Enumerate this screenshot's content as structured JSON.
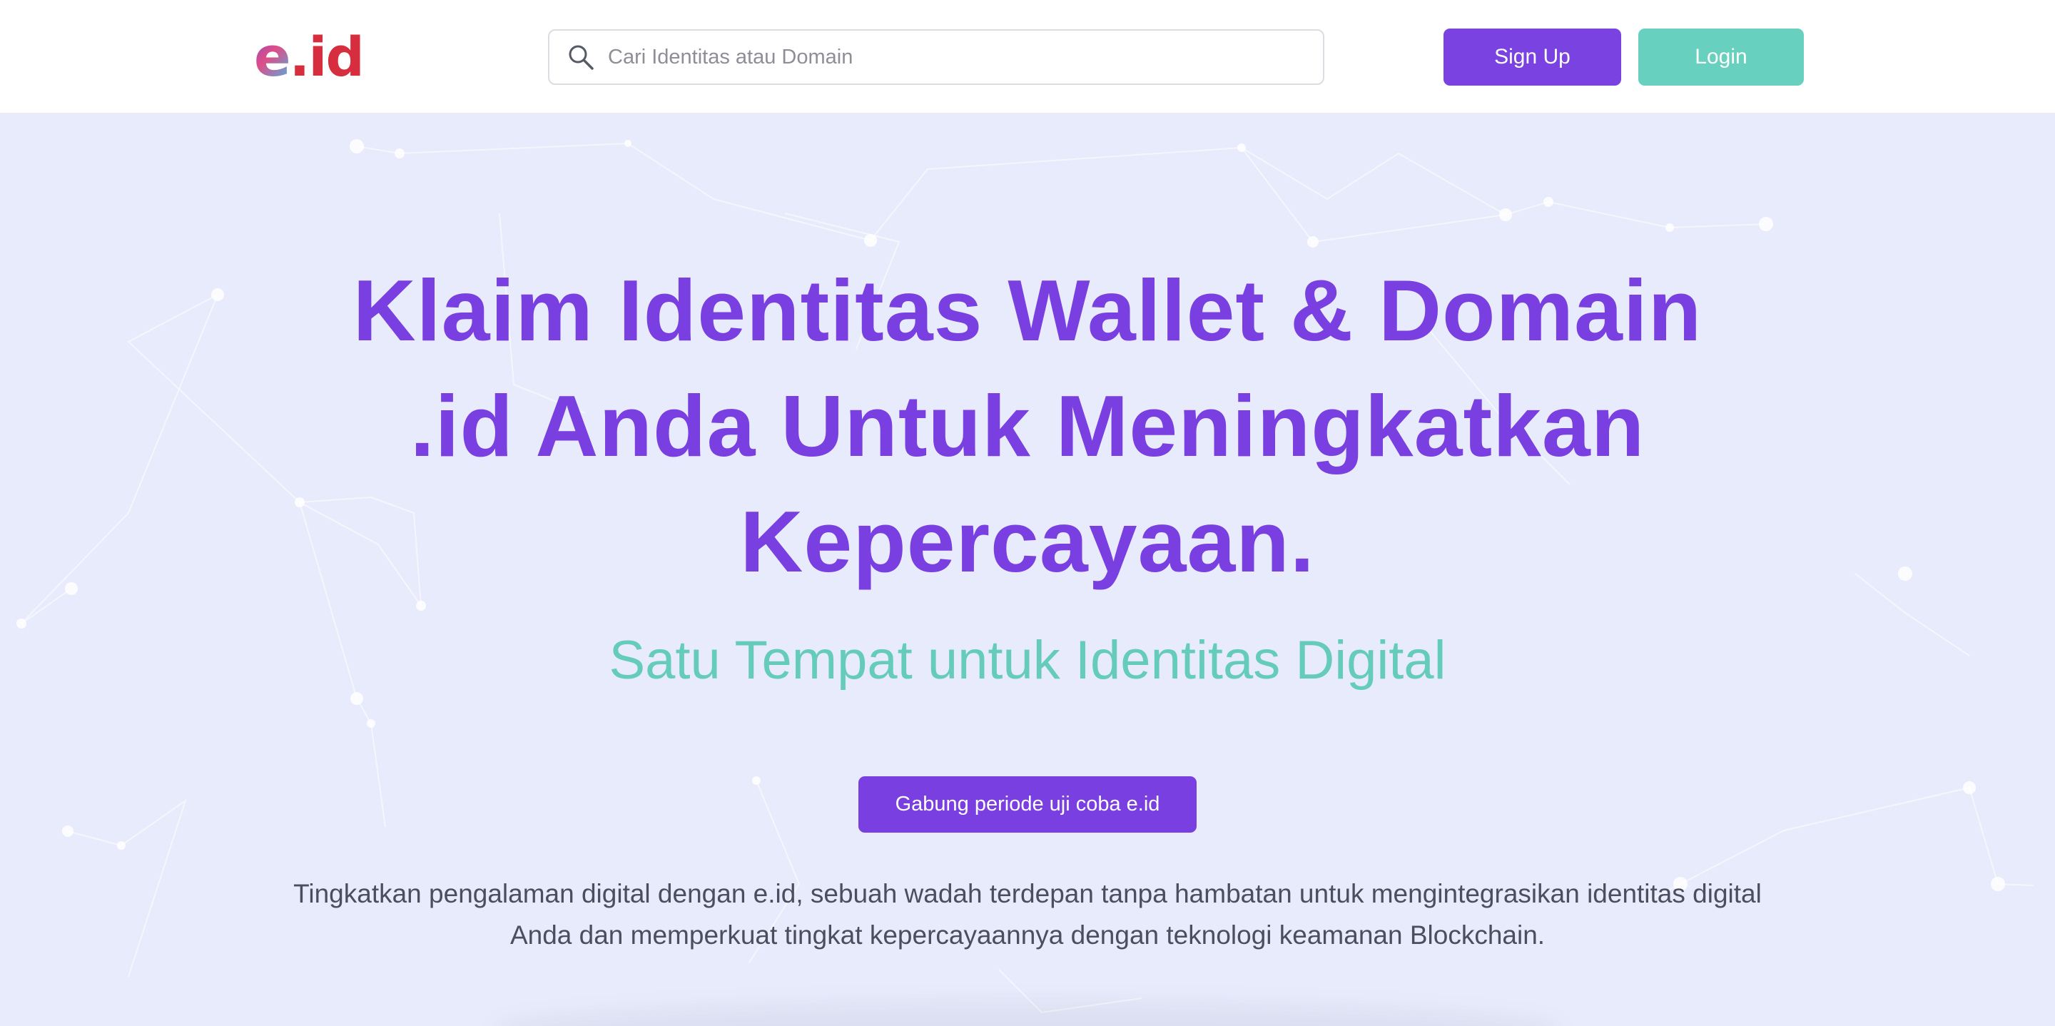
{
  "brand": {
    "logo_e": "e",
    "logo_id": ".id",
    "primary_color": "#7a3fe0",
    "accent_color": "#67d0bf"
  },
  "header": {
    "search": {
      "placeholder": "Cari Identitas atau Domain",
      "value": "",
      "icon": "search-icon"
    },
    "signup_label": "Sign Up",
    "login_label": "Login"
  },
  "hero": {
    "title_lines": [
      "Klaim Identitas Wallet & Domain",
      ".id Anda Untuk Meningkatkan",
      "Kepercayaan."
    ],
    "subtitle": "Satu Tempat untuk Identitas Digital",
    "cta_label": "Gabung periode uji coba e.id",
    "description_lines": [
      "Tingkatkan pengalaman digital dengan e.id, sebuah wadah terdepan tanpa hambatan untuk mengintegrasikan identitas digital",
      "Anda dan memperkuat tingkat kepercayaannya dengan teknologi keamanan Blockchain."
    ]
  }
}
